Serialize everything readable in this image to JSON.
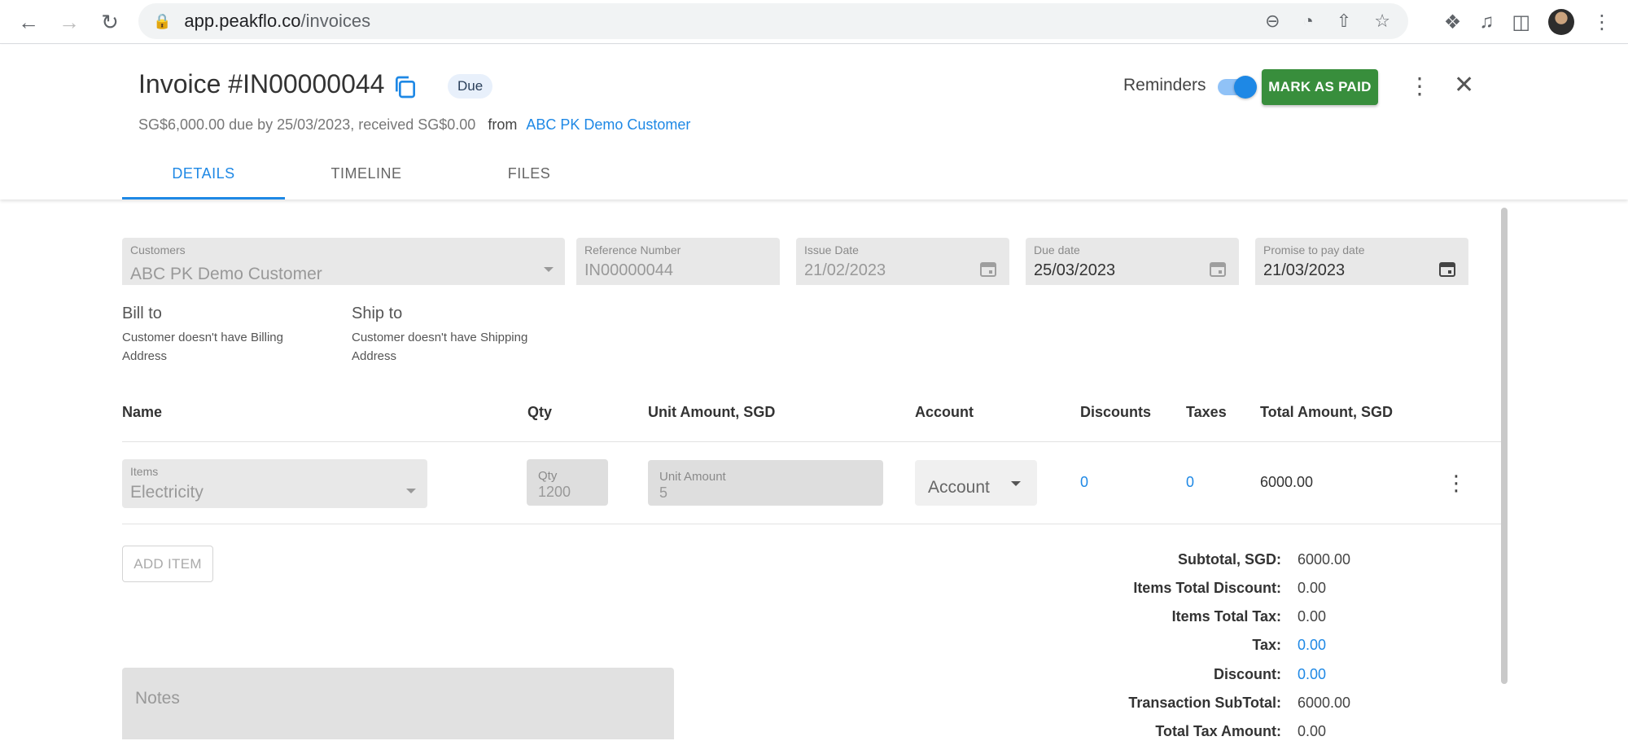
{
  "browser": {
    "url_host": "app.peakflo.co",
    "url_path": "/invoices"
  },
  "invoice": {
    "title": "Invoice #IN00000044",
    "status": "Due",
    "summary": "SG$6,000.00 due by 25/03/2023, received SG$0.00",
    "from_label": "from",
    "customer_link": "ABC PK Demo Customer"
  },
  "actions": {
    "reminders_label": "Reminders",
    "reminders_on": true,
    "mark_paid_label": "MARK AS PAID"
  },
  "tabs": [
    {
      "label": "DETAILS",
      "active": true
    },
    {
      "label": "TIMELINE",
      "active": false
    },
    {
      "label": "FILES",
      "active": false
    }
  ],
  "fields": {
    "customers": {
      "label": "Customers",
      "value": "ABC PK Demo Customer"
    },
    "reference": {
      "label": "Reference Number",
      "value": "IN00000044"
    },
    "issue_date": {
      "label": "Issue Date",
      "value": "21/02/2023"
    },
    "due_date": {
      "label": "Due date",
      "value": "25/03/2023"
    },
    "promise_date": {
      "label": "Promise to pay date",
      "value": "21/03/2023"
    }
  },
  "addresses": {
    "bill_to_label": "Bill to",
    "bill_to_text": "Customer doesn't have Billing Address",
    "ship_to_label": "Ship to",
    "ship_to_text": "Customer doesn't have Shipping Address"
  },
  "table": {
    "headers": [
      "Name",
      "Qty",
      "Unit Amount, SGD",
      "Account",
      "Discounts",
      "Taxes",
      "Total Amount, SGD"
    ],
    "rows": [
      {
        "items_label": "Items",
        "item": "Electricity",
        "qty_label": "Qty",
        "qty": "1200",
        "unit_label": "Unit Amount",
        "unit": "5",
        "account": "Account",
        "discounts": "0",
        "taxes": "0",
        "total": "6000.00"
      }
    ]
  },
  "add_item_label": "ADD ITEM",
  "notes_label": "Notes",
  "summary": [
    {
      "label": "Subtotal, SGD:",
      "value": "6000.00",
      "link": false
    },
    {
      "label": "Items Total Discount:",
      "value": "0.00",
      "link": false
    },
    {
      "label": "Items Total Tax:",
      "value": "0.00",
      "link": false
    },
    {
      "label": "Tax:",
      "value": "0.00",
      "link": true
    },
    {
      "label": "Discount:",
      "value": "0.00",
      "link": true
    },
    {
      "label": "Transaction SubTotal:",
      "value": "6000.00",
      "link": false
    },
    {
      "label": "Total Tax Amount:",
      "value": "0.00",
      "link": false
    }
  ],
  "colors": {
    "accent": "#1e88e5",
    "mark_paid": "#388e3c"
  }
}
